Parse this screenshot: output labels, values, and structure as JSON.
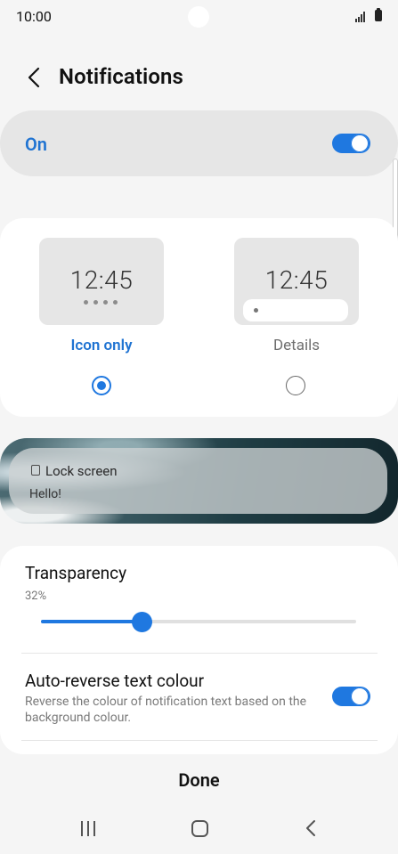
{
  "status_bar": {
    "time": "10:00"
  },
  "header": {
    "title": "Notifications"
  },
  "master": {
    "label": "On",
    "enabled": true
  },
  "style_options": {
    "preview_time": "12:45",
    "items": [
      {
        "label": "Icon only",
        "selected": true,
        "color": "#1f73d2"
      },
      {
        "label": "Details",
        "selected": false,
        "color": "#6e6e6e"
      }
    ]
  },
  "lock_preview": {
    "app_name": "Lock screen",
    "message": "Hello!"
  },
  "transparency": {
    "title": "Transparency",
    "value_text": "32%",
    "value": 0.32
  },
  "auto_reverse": {
    "title": "Auto-reverse text colour",
    "description": "Reverse the colour of notification text based on the background colour.",
    "enabled": true
  },
  "footer": {
    "done_label": "Done"
  },
  "colors": {
    "accent": "#1f78e0",
    "background": "#f5f5f5"
  }
}
